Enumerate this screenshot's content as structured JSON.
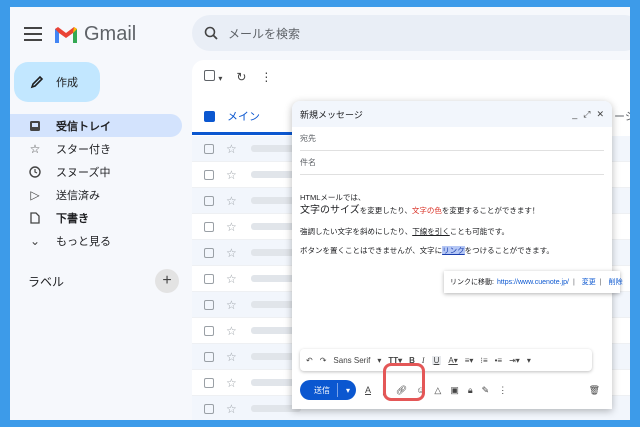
{
  "app": {
    "name": "Gmail",
    "compose_label": "作成"
  },
  "search": {
    "placeholder": "メールを検索"
  },
  "sidebar": {
    "items": [
      {
        "label": "受信トレイ",
        "icon": "inbox-icon"
      },
      {
        "label": "スター付き",
        "icon": "star-icon"
      },
      {
        "label": "スヌーズ中",
        "icon": "clock-icon"
      },
      {
        "label": "送信済み",
        "icon": "send-icon"
      },
      {
        "label": "下書き",
        "icon": "draft-icon"
      },
      {
        "label": "もっと見る",
        "icon": "chevron-down-icon"
      }
    ],
    "labels_heading": "ラベル"
  },
  "list": {
    "tab_primary": "メイン",
    "tab_partial": "ーシ"
  },
  "compose": {
    "title": "新規メッセージ",
    "to_placeholder": "宛先",
    "subject_placeholder": "件名",
    "body": {
      "line1": "HTMLメールでは、",
      "line2_big": "文字のサイズ",
      "line2_mid": "を変更したり、",
      "line2_red": "文字の色",
      "line2_end": "を変更することができます！",
      "line3_start": "強調したい文字を斜めにしたり、",
      "line3_ul": "下線を引く",
      "line3_end": "ことも可能です。",
      "line4_start": "ボタンを置くことはできませんが、文字に",
      "line4_hl": "リンク",
      "line4_end": "をつけることができます。"
    },
    "link_popup": {
      "prefix": "リンクに移動:",
      "url": "https://www.cuenote.jp/",
      "change": "変更",
      "remove": "削除"
    },
    "format_bar": {
      "font": "Sans Serif"
    },
    "send_label": "送信"
  },
  "colors": {
    "accent": "#0b57d0",
    "callout": "#e45757",
    "border": "#3d9be9"
  }
}
